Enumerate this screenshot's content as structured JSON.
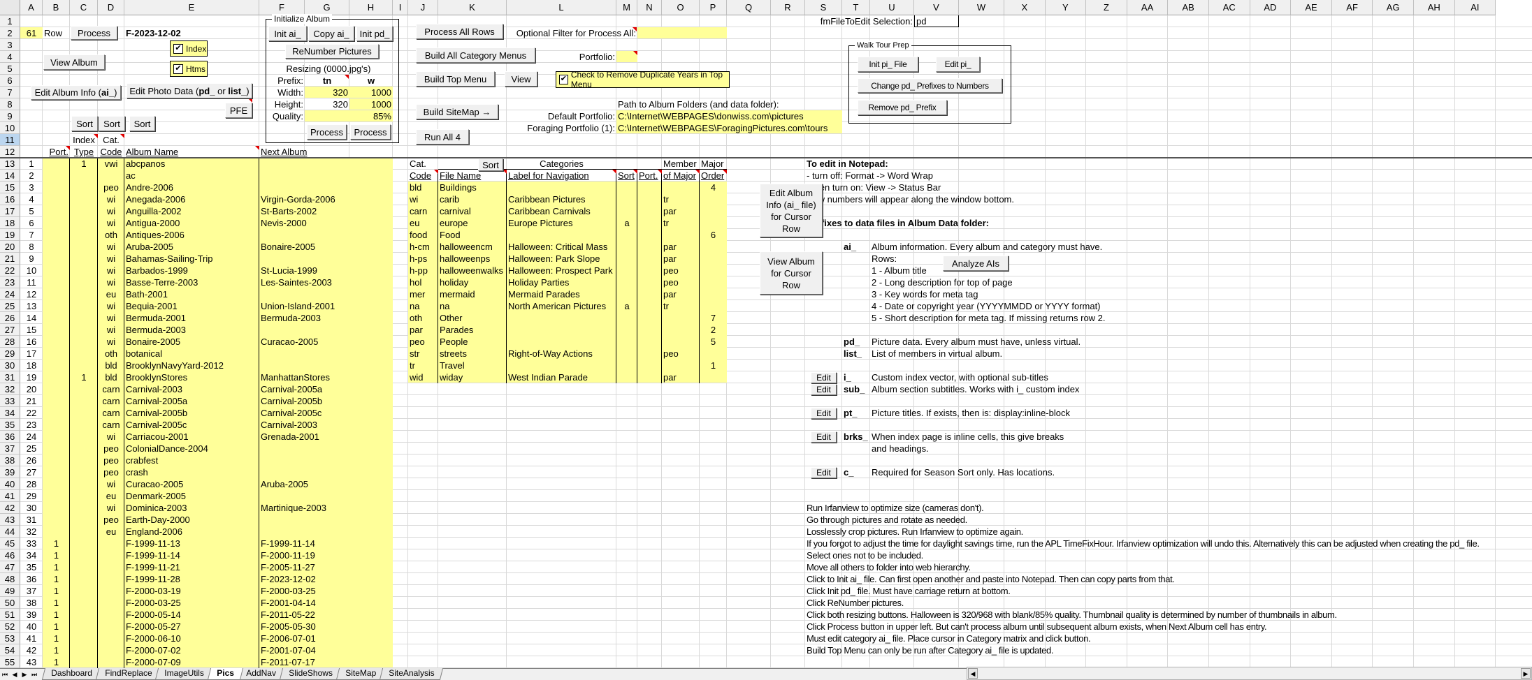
{
  "sheet": {
    "columns": [
      "A",
      "B",
      "C",
      "D",
      "E",
      "F",
      "G",
      "H",
      "I",
      "J",
      "K",
      "L",
      "M",
      "N",
      "O",
      "P",
      "Q",
      "R",
      "S",
      "T",
      "U",
      "V",
      "W",
      "X",
      "Y",
      "Z",
      "AA",
      "AB",
      "AC",
      "AD",
      "AE",
      "AF",
      "AG",
      "AH",
      "AI"
    ],
    "row_count": 55,
    "selected_row": 11,
    "tabs": [
      "Dashboard",
      "FindReplace",
      "ImageUtils",
      "Pics",
      "AddNav",
      "SlideShows",
      "SiteMap",
      "SiteAnalysis"
    ],
    "active_tab": "Pics",
    "tab_nav_icons": [
      "first-sheet-icon",
      "prev-sheet-icon",
      "next-sheet-icon",
      "last-sheet-icon"
    ]
  },
  "colors": {
    "input_yellow": "#ffff99",
    "comment_marker": "#e00000"
  },
  "controls": {
    "row_value": "61",
    "row_label": "Row",
    "process": "Process",
    "current_album": "F-2023-12-02",
    "index_checkbox": {
      "label": "Index",
      "checked": true,
      "mark": "✔"
    },
    "htms_checkbox": {
      "label": "Htms",
      "checked": true,
      "mark": "✔"
    },
    "view_album": "View Album",
    "edit_album_info": {
      "prefix": "Edit Album Info (",
      "bold": "ai_",
      "suffix": ")"
    },
    "edit_photo_data": {
      "prefix": "Edit Photo Data (",
      "bold1": "pd_",
      "mid": " or ",
      "bold2": "list_",
      "suffix": ")"
    },
    "pfe": "PFE",
    "sort": "Sort"
  },
  "init_album": {
    "title": "Initialize Album",
    "init_ai": "Init ai_",
    "copy_ai": "Copy ai_",
    "init_pd": "Init pd_",
    "renumber": "ReNumber Pictures",
    "resizing": "Resizing (0000.jpg's)",
    "prefix_label": "Prefix:",
    "tn": "tn",
    "w": "w",
    "width_label": "Width:",
    "width_tn": "320",
    "width_w": "1000",
    "height_label": "Height:",
    "height_tn": "320",
    "height_w": "1000",
    "quality_label": "Quality:",
    "quality": "85%",
    "process": "Process"
  },
  "album_table": {
    "headers": {
      "index": "Index",
      "cat": "Cat.",
      "port": "Port.",
      "type": "Type",
      "code": "Code",
      "album_name": "Album Name",
      "next_album": "Next Album"
    },
    "rows": [
      [
        "1",
        "",
        "1",
        "vwi",
        "abcpanos",
        ""
      ],
      [
        "2",
        "",
        "",
        "",
        "ac",
        ""
      ],
      [
        "3",
        "",
        "",
        "peo",
        "Andre-2006",
        ""
      ],
      [
        "4",
        "",
        "",
        "wi",
        "Anegada-2006",
        "Virgin-Gorda-2006"
      ],
      [
        "5",
        "",
        "",
        "wi",
        "Anguilla-2002",
        "St-Barts-2002"
      ],
      [
        "6",
        "",
        "",
        "wi",
        "Antigua-2000",
        "Nevis-2000"
      ],
      [
        "7",
        "",
        "",
        "oth",
        "Antiques-2006",
        ""
      ],
      [
        "8",
        "",
        "",
        "wi",
        "Aruba-2005",
        "Bonaire-2005"
      ],
      [
        "9",
        "",
        "",
        "wi",
        "Bahamas-Sailing-Trip",
        ""
      ],
      [
        "10",
        "",
        "",
        "wi",
        "Barbados-1999",
        "St-Lucia-1999"
      ],
      [
        "11",
        "",
        "",
        "wi",
        "Basse-Terre-2003",
        "Les-Saintes-2003"
      ],
      [
        "12",
        "",
        "",
        "eu",
        "Bath-2001",
        ""
      ],
      [
        "13",
        "",
        "",
        "wi",
        "Bequia-2001",
        "Union-Island-2001"
      ],
      [
        "14",
        "",
        "",
        "wi",
        "Bermuda-2001",
        "Bermuda-2003"
      ],
      [
        "15",
        "",
        "",
        "wi",
        "Bermuda-2003",
        ""
      ],
      [
        "16",
        "",
        "",
        "wi",
        "Bonaire-2005",
        "Curacao-2005"
      ],
      [
        "17",
        "",
        "",
        "oth",
        "botanical",
        ""
      ],
      [
        "18",
        "",
        "",
        "bld",
        "BrooklynNavyYard-2012",
        ""
      ],
      [
        "19",
        "",
        "1",
        "bld",
        "BrooklynStores",
        "ManhattanStores"
      ],
      [
        "20",
        "",
        "",
        "carn",
        "Carnival-2003",
        "Carnival-2005a"
      ],
      [
        "21",
        "",
        "",
        "carn",
        "Carnival-2005a",
        "Carnival-2005b"
      ],
      [
        "22",
        "",
        "",
        "carn",
        "Carnival-2005b",
        "Carnival-2005c"
      ],
      [
        "23",
        "",
        "",
        "carn",
        "Carnival-2005c",
        "Carnival-2003"
      ],
      [
        "24",
        "",
        "",
        "wi",
        "Carriacou-2001",
        "Grenada-2001"
      ],
      [
        "25",
        "",
        "",
        "peo",
        "ColonialDance-2004",
        ""
      ],
      [
        "26",
        "",
        "",
        "peo",
        "crabfest",
        ""
      ],
      [
        "27",
        "",
        "",
        "peo",
        "crash",
        ""
      ],
      [
        "28",
        "",
        "",
        "wi",
        "Curacao-2005",
        "Aruba-2005"
      ],
      [
        "29",
        "",
        "",
        "eu",
        "Denmark-2005",
        ""
      ],
      [
        "30",
        "",
        "",
        "wi",
        "Dominica-2003",
        "Martinique-2003"
      ],
      [
        "31",
        "",
        "",
        "peo",
        "Earth-Day-2000",
        ""
      ],
      [
        "32",
        "",
        "",
        "eu",
        "England-2006",
        ""
      ],
      [
        "33",
        "1",
        "",
        "",
        "F-1999-11-13",
        "F-1999-11-14"
      ],
      [
        "34",
        "1",
        "",
        "",
        "F-1999-11-14",
        "F-2000-11-19"
      ],
      [
        "35",
        "1",
        "",
        "",
        "F-1999-11-21",
        "F-2005-11-27"
      ],
      [
        "36",
        "1",
        "",
        "",
        "F-1999-11-28",
        "F-2023-12-02"
      ],
      [
        "37",
        "1",
        "",
        "",
        "F-2000-03-19",
        "F-2000-03-25"
      ],
      [
        "38",
        "1",
        "",
        "",
        "F-2000-03-25",
        "F-2001-04-14"
      ],
      [
        "39",
        "1",
        "",
        "",
        "F-2000-05-14",
        "F-2011-05-22"
      ],
      [
        "40",
        "1",
        "",
        "",
        "F-2000-05-27",
        "F-2005-05-30"
      ],
      [
        "41",
        "1",
        "",
        "",
        "F-2000-06-10",
        "F-2006-07-01"
      ],
      [
        "42",
        "1",
        "",
        "",
        "F-2000-07-02",
        "F-2001-07-04"
      ],
      [
        "43",
        "1",
        "",
        "",
        "F-2000-07-09",
        "F-2011-07-17"
      ]
    ]
  },
  "process_panel": {
    "process_all_rows": "Process All Rows",
    "filter_label": "Optional Filter for Process All:",
    "filter_value": "",
    "build_category_menus": "Build All Category Menus",
    "portfolio_label": "Portfolio:",
    "portfolio_value": "",
    "build_top_menu": "Build Top Menu",
    "view": "View",
    "remove_dup_years": {
      "label": "Check to Remove Duplicate Years in Top Menu",
      "checked": true,
      "mark": "✔"
    },
    "build_sitemap": "Build SiteMap →",
    "run_all": "Run All 4",
    "path_title": "Path to Album Folders (and data folder):",
    "default_portfolio_label": "Default Portfolio:",
    "default_portfolio_path": "C:\\Internet\\WEBPAGES\\donwiss.com\\pictures",
    "foraging_portfolio_label": "Foraging Portfolio (1):",
    "foraging_portfolio_path": "C:\\Internet\\WEBPAGES\\ForagingPictures.com\\tours"
  },
  "file_to_edit": {
    "label": "fmFileToEdit Selection:",
    "value": "pd"
  },
  "walk_tour": {
    "title": "Walk Tour Prep",
    "init_pi": "Init pi_ File",
    "edit_pi": "Edit pi_",
    "change_prefixes": "Change pd_ Prefixes to Numbers",
    "remove_prefix": "Remove pd_ Prefix"
  },
  "category_table": {
    "headers_top": {
      "cat": "Cat.",
      "sort_button": "Sort",
      "categories": "Categories",
      "member": "Member",
      "major": "Major"
    },
    "headers": [
      "Code",
      "File Name",
      "Label for Navigation",
      "Sort",
      "Port.",
      "of Major",
      "Order"
    ],
    "rows": [
      [
        "bld",
        "Buildings",
        "",
        "",
        "",
        "",
        "4"
      ],
      [
        "wi",
        "carib",
        "Caribbean Pictures",
        "",
        "",
        "tr",
        ""
      ],
      [
        "carn",
        "carnival",
        "Caribbean Carnivals",
        "",
        "",
        "par",
        ""
      ],
      [
        "eu",
        "europe",
        "Europe Pictures",
        "a",
        "",
        "tr",
        ""
      ],
      [
        "food",
        "Food",
        "",
        "",
        "",
        "",
        "6"
      ],
      [
        "h-cm",
        "halloweencm",
        "Halloween: Critical Mass",
        "",
        "",
        "par",
        ""
      ],
      [
        "h-ps",
        "halloweenps",
        "Halloween: Park Slope",
        "",
        "",
        "par",
        ""
      ],
      [
        "h-pp",
        "halloweenwalks",
        "Halloween: Prospect Park",
        "",
        "",
        "peo",
        ""
      ],
      [
        "hol",
        "holiday",
        "Holiday Parties",
        "",
        "",
        "peo",
        ""
      ],
      [
        "mer",
        "mermaid",
        "Mermaid Parades",
        "",
        "",
        "par",
        ""
      ],
      [
        "na",
        "na",
        "North American Pictures",
        "a",
        "",
        "tr",
        ""
      ],
      [
        "oth",
        "Other",
        "",
        "",
        "",
        "",
        "7"
      ],
      [
        "par",
        "Parades",
        "",
        "",
        "",
        "",
        "2"
      ],
      [
        "peo",
        "People",
        "",
        "",
        "",
        "",
        "5"
      ],
      [
        "str",
        "streets",
        "Right-of-Way Actions",
        "",
        "",
        "peo",
        ""
      ],
      [
        "tr",
        "Travel",
        "",
        "",
        "",
        "",
        "1"
      ],
      [
        "wid",
        "widay",
        "West Indian Parade",
        "",
        "",
        "par",
        ""
      ]
    ],
    "edit_album_info_button": "Edit Album Info (ai_ file) for Cursor Row",
    "view_album_button": "View Album for Cursor Row"
  },
  "notes": {
    "notepad_title": "To edit in Notepad:",
    "notepad_lines": [
      "- turn off: Format -> Word Wrap",
      "- then turn on: View -> Status Bar",
      "Row numbers will appear along the window bottom."
    ],
    "prefixes_title": "Prefixes to data files in Album Data folder:",
    "analyze_button": "Analyze AIs",
    "edit_button": "Edit",
    "prefixes": [
      {
        "prefix": "ai_",
        "edit": false,
        "lines": [
          "Album information. Every album and category must have.",
          "Rows:",
          "1 - Album title",
          "2 - Long description for top of page",
          "3 - Key words for meta tag",
          "4 - Date or copyright year (YYYYMMDD or YYYY format)",
          "5 - Short description for meta tag. If missing returns row 2."
        ]
      },
      {
        "prefix": "pd_",
        "edit": false,
        "lines": [
          "Picture data. Every album must have, unless virtual."
        ]
      },
      {
        "prefix": "list_",
        "edit": false,
        "lines": [
          "List of members in virtual album."
        ]
      },
      {
        "prefix": "i_",
        "edit": true,
        "lines": [
          "Custom index vector, with optional sub-titles"
        ]
      },
      {
        "prefix": "sub_",
        "edit": true,
        "lines": [
          "Album section subtitles. Works with i_ custom index"
        ]
      },
      {
        "prefix": "pt_",
        "edit": true,
        "lines": [
          "Picture titles. If exists, then is: display:inline-block"
        ]
      },
      {
        "prefix": "brks_",
        "edit": true,
        "lines": [
          "When index page is inline cells, this give breaks",
          "and headings."
        ]
      },
      {
        "prefix": "c_",
        "edit": true,
        "lines": [
          "Required for Season Sort only. Has locations."
        ]
      }
    ],
    "steps": [
      "Run Irfanview to optimize size (cameras don't).",
      "Go through pictures and rotate as needed.",
      "Losslessly crop pictures. Run Irfanview to optimize again.",
      "If you forgot to adjust the time for daylight savings time, run the APL TimeFixHour. Irfanview optimization will undo this. Alternatively this can be adjusted when creating the pd_ file.",
      "Select ones not to be included.",
      "Move all others to folder into web hierarchy.",
      "Click to Init ai_ file. Can first open another and paste into Notepad. Then can copy parts from that.",
      "Click Init pd_ file. Must have carriage return at bottom.",
      "Click ReNumber pictures.",
      "Click both resizing buttons. Halloween is 320/968 with blank/85% quality. Thumbnail quality is determined by number of thumbnails in album.",
      "Click Process button in upper left. But can't process album until subsequent album exists, when Next Album cell has entry.",
      "Must edit category ai_ file. Place cursor in Category matrix and click button.",
      "Build Top Menu can only be run after Category ai_ file is updated."
    ]
  }
}
